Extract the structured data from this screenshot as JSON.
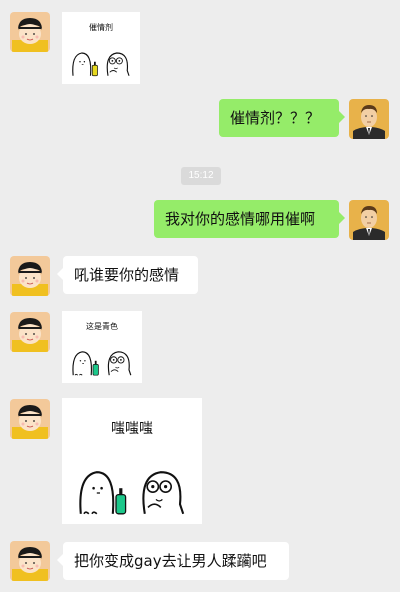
{
  "messages": [
    {
      "sticker_caption": "催情剂"
    },
    {
      "text": "催情剂？？？"
    },
    {
      "timestamp": "15:12"
    },
    {
      "text": "我对你的感情哪用催啊"
    },
    {
      "text": "吼谁要你的感情"
    },
    {
      "sticker_caption": "这是青色"
    },
    {
      "sticker_caption": "嗤嗤嗤"
    },
    {
      "text": "把你变成gay去让男人蹂躏吧"
    }
  ],
  "icons": {
    "left_avatar": "girl-cartoon-avatar",
    "right_avatar": "man-suit-avatar",
    "sticker": "ghost-creatures-sticker"
  },
  "colors": {
    "background": "#ededed",
    "sent_bubble": "#95ec69",
    "received_bubble": "#ffffff",
    "timestamp_bg": "#dadada"
  }
}
